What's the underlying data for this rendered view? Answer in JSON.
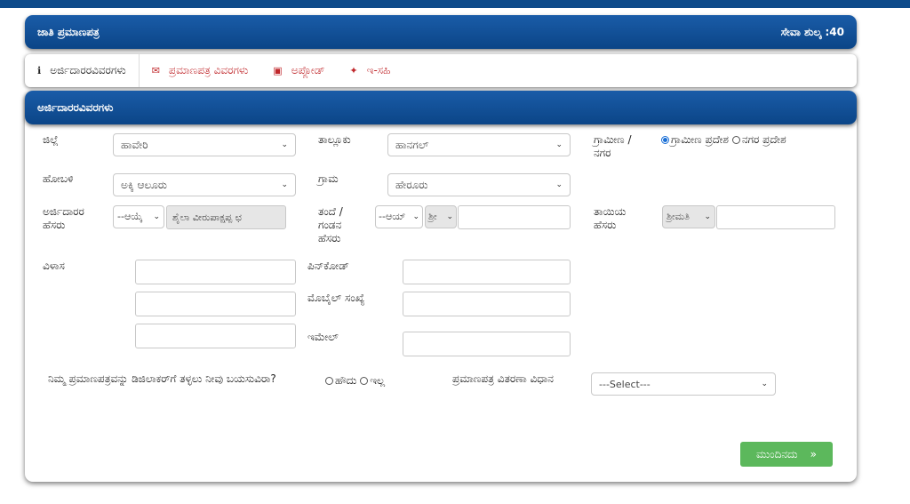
{
  "header": {
    "title": "ಜಾತಿ ಪ್ರಮಾಣಪತ್ರ",
    "fee": "ಸೇವಾ ಶುಲ್ಕ :40"
  },
  "tabs": [
    {
      "label": "ಅರ್ಜಿದಾರರವಿವರಗಳು",
      "icon": "info-icon"
    },
    {
      "label": "ಪ್ರಮಾಣಪತ್ರ ವಿವರಗಳು",
      "icon": "envelope-icon"
    },
    {
      "label": "ಅಪ್ಲೋಡ್",
      "icon": "image-icon"
    },
    {
      "label": "ಇ-ಸಹಿ",
      "icon": "pen-icon"
    }
  ],
  "section": {
    "title": "ಅರ್ಜಿದಾರರವಿವರಗಳು"
  },
  "form": {
    "district": {
      "label": "ಜಿಲ್ಲೆ",
      "value": "ಹಾವೇರಿ"
    },
    "taluk": {
      "label": "ತಾಲ್ಲೂಕು",
      "value": "ಹಾನಗಲ್"
    },
    "area_type": {
      "label": "ಗ್ರಾಮೀಣ / ನಗರ",
      "option_rural": "ಗ್ರಾಮೀಣ ಪ್ರದೇಶ",
      "option_urban": "ನಗರ ಪ್ರದೇಶ",
      "selected": "rural"
    },
    "hobli": {
      "label": "ಹೋಬಳಿ",
      "value": "ಅಕ್ಕಿ ಆಲೂರು"
    },
    "village": {
      "label": "ಗ್ರಾಮ",
      "value": "ಹೇರೂರು"
    },
    "applicant_name": {
      "label": "ಅರ್ಜಿದಾರರ ಹೆಸರು",
      "prefix": "--ಆಯ್ಕೆ",
      "value": "ಶೈಲಾ ವೀರುಪಾಕ್ಷಪ್ಪ ಛ"
    },
    "father_name": {
      "label": "ತಂದೆ / ಗಂಡನ ಹೆಸರು",
      "prefix": "--ಆಯ್",
      "title": "ಶ್ರೀ",
      "value": ""
    },
    "mother_name": {
      "label": "ತಾಯಿಯ ಹೆಸರು",
      "title": "ಶ್ರೀಮತಿ",
      "value": ""
    },
    "address": {
      "label": "ವಿಳಾಸ",
      "line1": "",
      "line2": "",
      "line3": ""
    },
    "pincode": {
      "label": "ಪಿನ್‌ಕೋಡ್",
      "value": ""
    },
    "mobile": {
      "label": "ಮೊಬೈಲ್ ಸಂಖ್ಯೆ",
      "value": ""
    },
    "email": {
      "label": "ಇಮೇಲ್",
      "value": ""
    },
    "digilocker": {
      "question": "ನಿಮ್ಮ ಪ್ರಮಾಣಪತ್ರವನ್ನು ಡಿಜಿಲಾಕರ್‌ಗೆ ತಳ್ಳಲು ನೀವು ಬಯಸುವಿರಾ?",
      "yes": "ಹೌದು",
      "no": "ಇಲ್ಲ"
    },
    "delivery": {
      "label": "ಪ್ರಮಾಣಪತ್ರ ವಿತರಣಾ ವಿಧಾನ",
      "value": "---Select---"
    }
  },
  "actions": {
    "next_label": "ಮುಂದಿನದು",
    "next_arrow": "»"
  }
}
